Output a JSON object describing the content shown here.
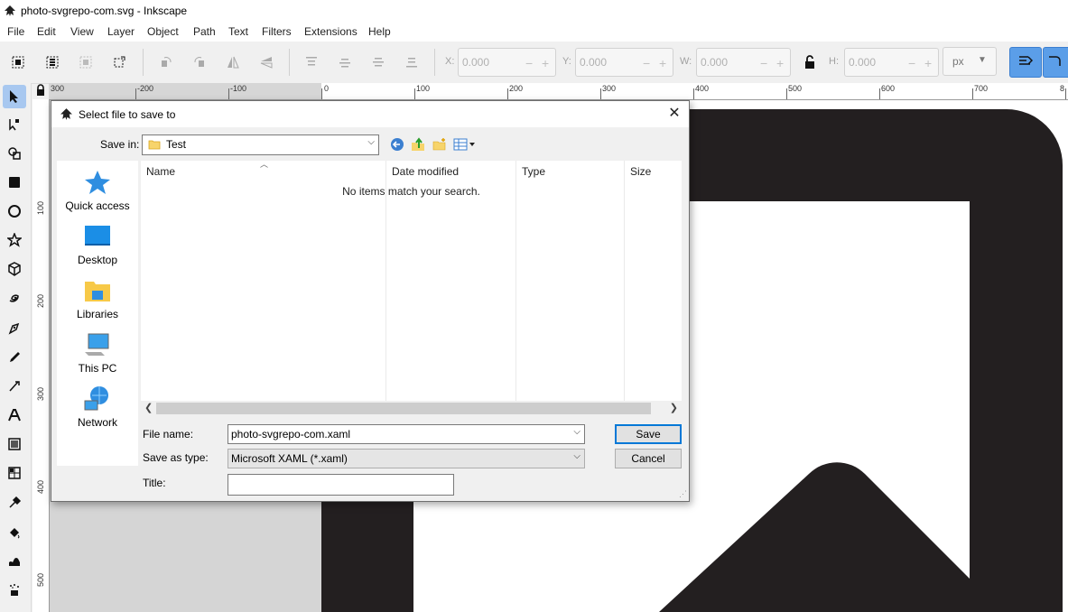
{
  "window": {
    "title": "photo-svgrepo-com.svg - Inkscape"
  },
  "menu": [
    "File",
    "Edit",
    "View",
    "Layer",
    "Object",
    "Path",
    "Text",
    "Filters",
    "Extensions",
    "Help"
  ],
  "toolbar": {
    "x_label": "X:",
    "x_value": "0.000",
    "y_label": "Y:",
    "y_value": "0.000",
    "w_label": "W:",
    "w_value": "0.000",
    "h_label": "H:",
    "h_value": "0.000",
    "unit": "px"
  },
  "rulers": {
    "horizontal": [
      "300",
      "-200",
      "-100",
      "0",
      "100",
      "200",
      "300",
      "400",
      "500",
      "600",
      "700",
      "8"
    ],
    "vertical": [
      "100",
      "200",
      "300",
      "400",
      "500"
    ]
  },
  "dialog": {
    "title": "Select file to save to",
    "save_in_label": "Save in:",
    "save_in_value": "Test",
    "places": [
      {
        "label": "Quick access",
        "icon": "star-icon"
      },
      {
        "label": "Desktop",
        "icon": "desktop-icon"
      },
      {
        "label": "Libraries",
        "icon": "libraries-icon"
      },
      {
        "label": "This PC",
        "icon": "computer-icon"
      },
      {
        "label": "Network",
        "icon": "network-icon"
      }
    ],
    "columns": [
      "Name",
      "Date modified",
      "Type",
      "Size"
    ],
    "empty_message": "No items match your search.",
    "file_name_label": "File name:",
    "file_name_value": "photo-svgrepo-com.xaml",
    "save_type_label": "Save as type:",
    "save_type_value": "Microsoft XAML (*.xaml)",
    "title_label": "Title:",
    "title_value": "",
    "save_button": "Save",
    "cancel_button": "Cancel"
  },
  "colors": {
    "accent": "#0078d7",
    "canvas_shape": "#231f20",
    "selected_tool": "#a8c8f0"
  }
}
